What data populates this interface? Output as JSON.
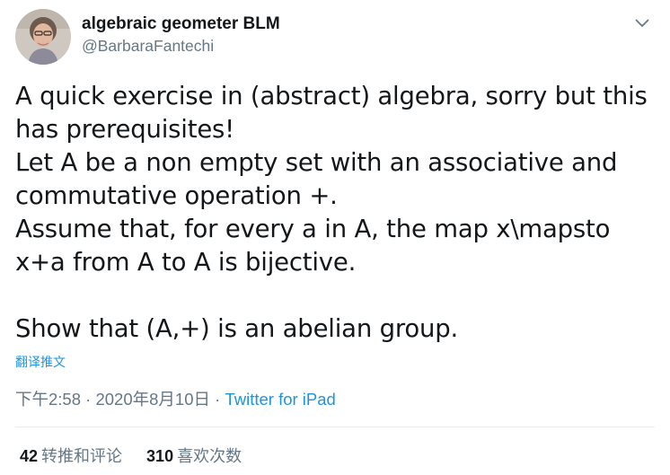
{
  "author": {
    "display_name": "algebraic geometer BLM",
    "handle": "@BarbaraFantechi"
  },
  "tweet": {
    "lines": [
      "A quick exercise in (abstract) algebra, sorry but this",
      "has prerequisites!",
      "Let A be a non empty set with an associative and",
      "commutative operation +.",
      "Assume that, for every a in A, the map x\\mapsto",
      "x+a from A to A is bijective.",
      "",
      "Show that (A,+) is an abelian group."
    ],
    "translate_label": "翻译推文"
  },
  "meta": {
    "time": "下午2:58",
    "separator1": " · ",
    "date": "2020年8月10日",
    "separator2": " · ",
    "source": "Twitter for iPad"
  },
  "stats": {
    "retweets_count": "42",
    "retweets_label": "转推和评论",
    "likes_count": "310",
    "likes_label": "喜欢次数"
  },
  "icons": {
    "menu": "chevron-down-icon",
    "avatar": "avatar"
  },
  "colors": {
    "link": "#1b95e0",
    "secondary_text": "#657786",
    "primary_text": "#14171a",
    "divider": "#e6ecf0"
  }
}
